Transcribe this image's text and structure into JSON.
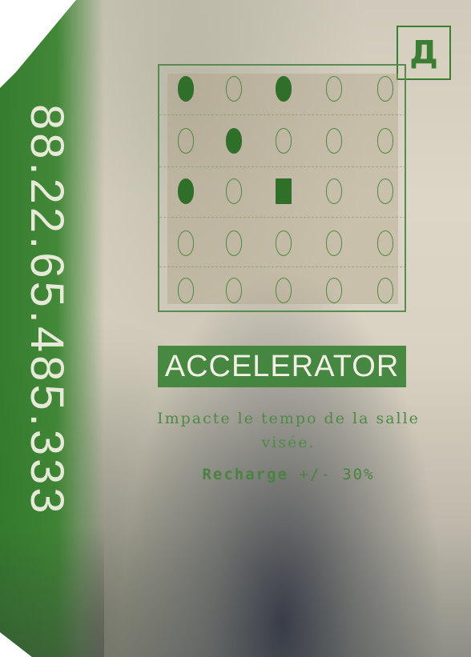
{
  "card": {
    "serial_number": "88.22.65.485.333",
    "type_glyph": "Д",
    "title": "ACCELERATOR",
    "description": "Impacte le tempo de la salle visée.",
    "recharge_label": "Recharge",
    "recharge_value": "+/- 30%",
    "colors": {
      "primary_green": "#3b7d33",
      "paper": "#d8d2c2",
      "text_light": "#f2efe4"
    }
  },
  "pattern": {
    "rows": 5,
    "cols": 5,
    "cells": [
      [
        "filled",
        "empty",
        "filled",
        "empty",
        "empty"
      ],
      [
        "empty",
        "filled",
        "empty",
        "empty",
        "empty"
      ],
      [
        "filled",
        "empty",
        "filled-square",
        "empty",
        "empty"
      ],
      [
        "empty",
        "empty",
        "empty",
        "empty",
        "empty"
      ],
      [
        "empty",
        "empty",
        "empty",
        "empty",
        "empty"
      ]
    ]
  }
}
